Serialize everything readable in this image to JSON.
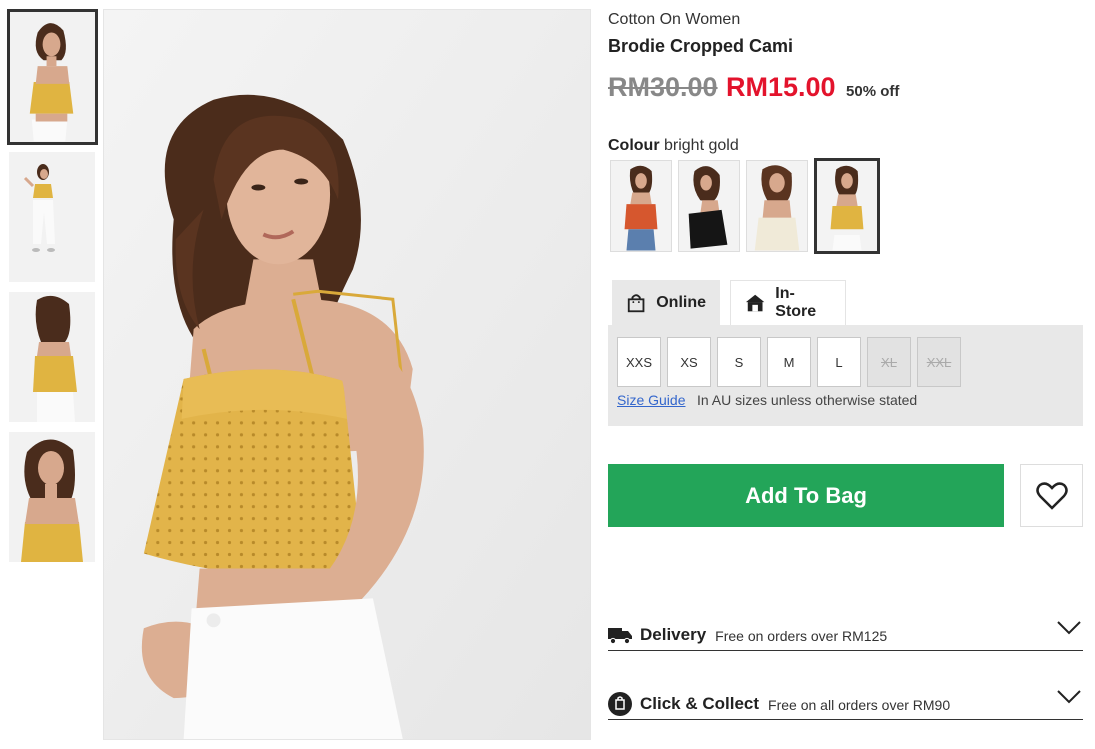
{
  "product": {
    "brand": "Cotton On Women",
    "title": "Brodie Cropped Cami",
    "price_old": "RM30.00",
    "price_new": "RM15.00",
    "discount": "50% off"
  },
  "colour": {
    "label": "Colour",
    "value": "bright gold",
    "swatches": [
      "orange",
      "black",
      "cream",
      "bright gold"
    ]
  },
  "tabs": {
    "online": "Online",
    "instore": "In-Store"
  },
  "sizes": {
    "options": [
      {
        "label": "XXS",
        "available": true
      },
      {
        "label": "XS",
        "available": true
      },
      {
        "label": "S",
        "available": true
      },
      {
        "label": "M",
        "available": true
      },
      {
        "label": "L",
        "available": true
      },
      {
        "label": "XL",
        "available": false
      },
      {
        "label": "XXL",
        "available": false
      }
    ],
    "guide": "Size Guide",
    "note": "In AU sizes unless otherwise stated"
  },
  "actions": {
    "add_to_bag": "Add To Bag"
  },
  "accordions": {
    "delivery_title": "Delivery",
    "delivery_sub": "Free on orders over RM125",
    "collect_title": "Click & Collect",
    "collect_sub": "Free on all orders over RM90"
  },
  "icons": {
    "bag": "shopping-bag-icon",
    "store": "store-icon",
    "heart": "heart-icon",
    "truck": "delivery-truck-icon",
    "collect": "click-collect-icon",
    "chevron": "chevron-down-icon"
  },
  "colors": {
    "sale_red": "#e3132c",
    "cta_green": "#23a559",
    "top_yellow": "#e0b441"
  }
}
